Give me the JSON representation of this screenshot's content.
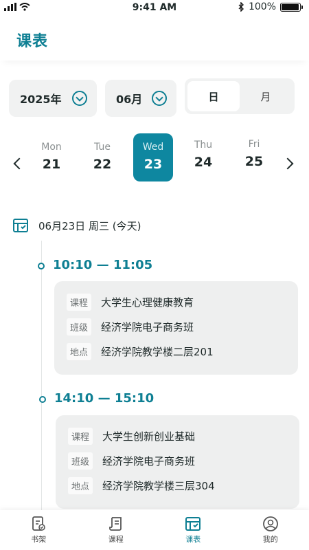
{
  "status_bar": {
    "time": "9:41 AM",
    "battery": "100%"
  },
  "header": {
    "title": "课表"
  },
  "selectors": {
    "year": "2025年",
    "month": "06月",
    "view_options": [
      "日",
      "月"
    ],
    "active_view": "日"
  },
  "week": [
    {
      "name": "Mon",
      "date": "21"
    },
    {
      "name": "Tue",
      "date": "22"
    },
    {
      "name": "Wed",
      "date": "23",
      "active": true
    },
    {
      "name": "Thu",
      "date": "24"
    },
    {
      "name": "Fri",
      "date": "25"
    }
  ],
  "date_heading": "06月23日 周三 (今天)",
  "schedule": [
    {
      "time": "10:10 — 11:05",
      "fields": [
        {
          "label": "课程",
          "value": "大学生心理健康教育"
        },
        {
          "label": "班级",
          "value": "经济学院电子商务班"
        },
        {
          "label": "地点",
          "value": "经济学院教学楼二层201"
        }
      ]
    },
    {
      "time": "14:10 — 15:10",
      "fields": [
        {
          "label": "课程",
          "value": "大学生创新创业基础"
        },
        {
          "label": "班级",
          "value": "经济学院电子商务班"
        },
        {
          "label": "地点",
          "value": "经济学院教学楼三层304"
        }
      ]
    }
  ],
  "nav": [
    {
      "label": "书架",
      "icon": "bookshelf-icon"
    },
    {
      "label": "课程",
      "icon": "course-icon"
    },
    {
      "label": "课表",
      "icon": "schedule-icon",
      "active": true
    },
    {
      "label": "我的",
      "icon": "profile-icon"
    }
  ],
  "colors": {
    "accent": "#0e7f93",
    "active_day": "#0e87a0"
  }
}
